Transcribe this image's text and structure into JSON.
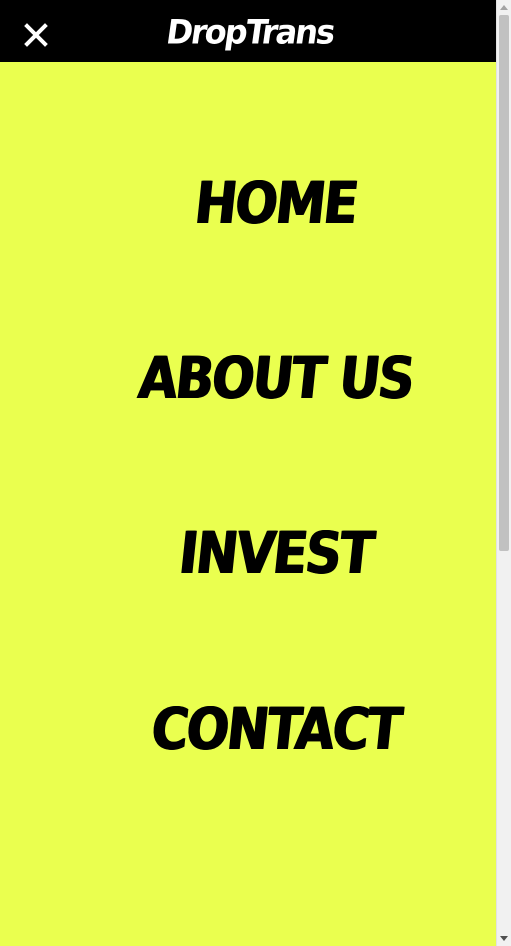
{
  "header": {
    "logo_text": "DropTrans",
    "close_icon": "close-icon"
  },
  "menu": {
    "items": [
      {
        "label": "HOME"
      },
      {
        "label": "ABOUT US"
      },
      {
        "label": "INVEST"
      },
      {
        "label": "CONTACT"
      }
    ]
  },
  "colors": {
    "background": "#eaff4f",
    "header_background": "#000000",
    "menu_text": "#000000",
    "logo_text": "#ffffff"
  }
}
